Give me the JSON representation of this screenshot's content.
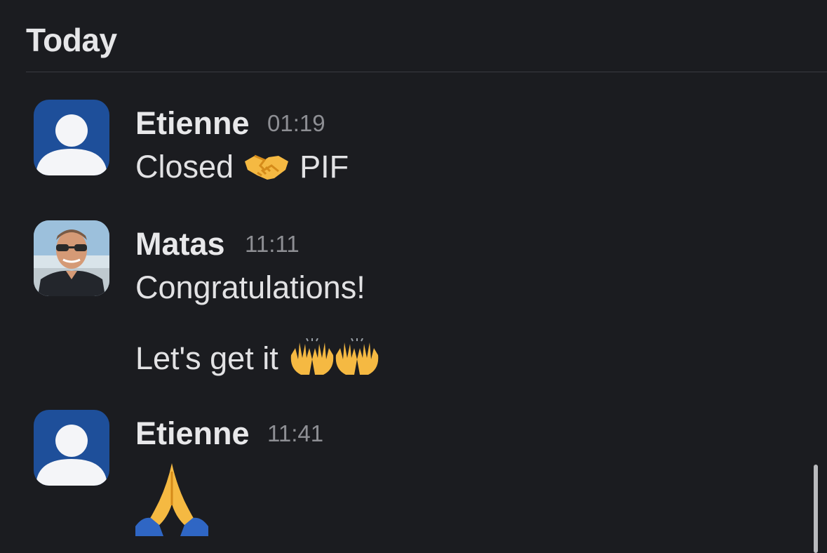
{
  "header": {
    "title": "Today"
  },
  "messages": [
    {
      "author": "Etienne",
      "time": "01:19",
      "avatar": "default-user-icon",
      "lines": [
        {
          "parts": [
            "Closed",
            "handshake-emoji",
            "PIF"
          ]
        }
      ]
    },
    {
      "author": "Matas",
      "time": "11:11",
      "avatar": "profile-photo",
      "lines": [
        {
          "text": "Congratulations!"
        },
        {
          "text": "Let's get it",
          "emoji": "raising-hands-emoji x2"
        }
      ]
    },
    {
      "author": "Etienne",
      "time": "11:41",
      "avatar": "default-user-icon",
      "lines": [
        {
          "emoji": "folded-hands-emoji"
        }
      ]
    }
  ],
  "text": {
    "m1_author": "Etienne",
    "m1_time": "01:19",
    "m1_word1": "Closed",
    "m1_word2": "PIF",
    "m2_author": "Matas",
    "m2_time": "11:11",
    "m2_line1": "Congratulations!",
    "m2_line2": "Let's get it",
    "m3_author": "Etienne",
    "m3_time": "11:41"
  },
  "colors": {
    "background": "#1b1c20",
    "avatar_default": "#1e4f9a",
    "text_primary": "#e8e8ea",
    "text_secondary": "#8e8f94"
  }
}
